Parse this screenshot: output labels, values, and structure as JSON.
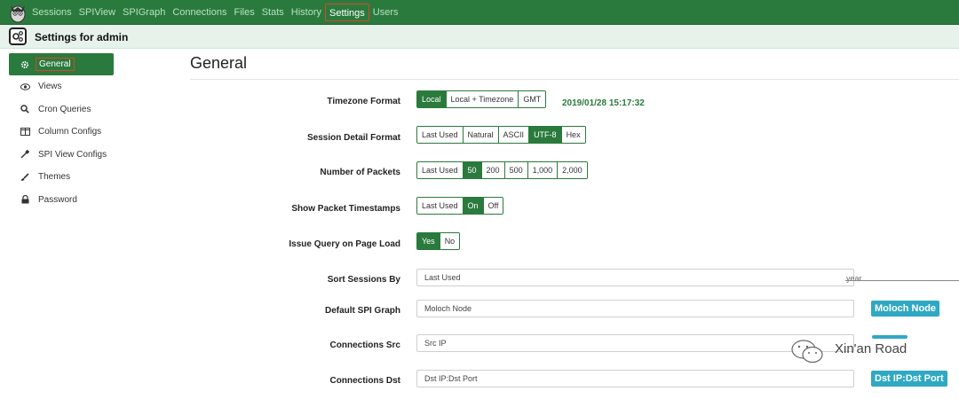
{
  "nav": {
    "items": [
      "Sessions",
      "SPIView",
      "SPIGraph",
      "Connections",
      "Files",
      "Stats",
      "History",
      "Settings",
      "Users"
    ],
    "active": "Settings"
  },
  "header": {
    "title": "Settings for admin"
  },
  "sidebar": {
    "items": [
      {
        "label": "General",
        "icon": "gear-icon"
      },
      {
        "label": "Views",
        "icon": "eye-icon"
      },
      {
        "label": "Cron Queries",
        "icon": "search-icon"
      },
      {
        "label": "Column Configs",
        "icon": "columns-icon"
      },
      {
        "label": "SPI View Configs",
        "icon": "eyedropper-icon"
      },
      {
        "label": "Themes",
        "icon": "paintbrush-icon"
      },
      {
        "label": "Password",
        "icon": "lock-icon"
      }
    ]
  },
  "main": {
    "title": "General",
    "timezone": {
      "label": "Timezone Format",
      "options": [
        "Local",
        "Local + Timezone",
        "GMT"
      ],
      "selected": "Local",
      "time": "2019/01/28 15:17:32"
    },
    "session_detail": {
      "label": "Session Detail Format",
      "options": [
        "Last Used",
        "Natural",
        "ASCII",
        "UTF-8",
        "Hex"
      ],
      "selected": "UTF-8"
    },
    "packets": {
      "label": "Number of Packets",
      "options": [
        "Last Used",
        "50",
        "200",
        "500",
        "1,000",
        "2,000"
      ],
      "selected": "50"
    },
    "timestamps": {
      "label": "Show Packet Timestamps",
      "options": [
        "Last Used",
        "On",
        "Off"
      ],
      "selected": "On"
    },
    "issue_query": {
      "label": "Issue Query on Page Load",
      "options": [
        "Yes",
        "No"
      ],
      "selected": "Yes"
    },
    "sort_sessions": {
      "label": "Sort Sessions By",
      "value": "Last Used"
    },
    "spi_graph": {
      "label": "Default SPI Graph",
      "value": "Moloch Node",
      "tag": "Moloch Node"
    },
    "conn_src": {
      "label": "Connections Src",
      "value": "Src IP"
    },
    "conn_dst": {
      "label": "Connections Dst",
      "value": "Dst IP:Dst Port",
      "tag": "Dst IP:Dst Port"
    }
  },
  "watermark": {
    "year": "year",
    "text": "Xin'an Road"
  },
  "colors": {
    "primary": "#2b7a3d",
    "accent": "#2fa8c4",
    "highlight": "#d9472b"
  }
}
